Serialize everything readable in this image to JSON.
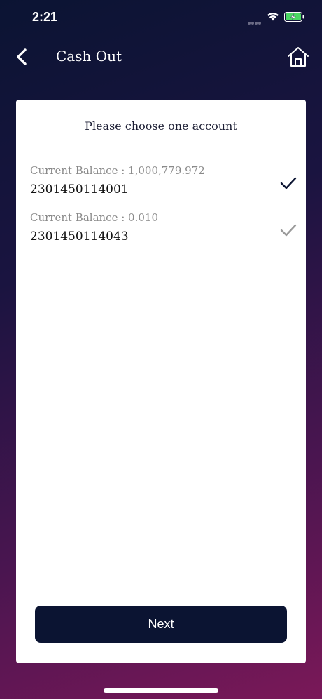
{
  "status_bar": {
    "time": "2:21",
    "icons": [
      "signal-dots-icon",
      "wifi-icon",
      "battery-charging-icon"
    ],
    "battery_color": "#4cd964"
  },
  "nav": {
    "title": "Cash Out",
    "back_icon": "chevron-left-icon",
    "home_icon": "home-icon"
  },
  "card": {
    "heading": "Please choose one account",
    "accounts": [
      {
        "balance_label": "Current Balance : 1,000,779.972",
        "number": "2301450114001",
        "selected": true,
        "check_color": "#0b1432"
      },
      {
        "balance_label": "Current Balance : 0.010",
        "number": "2301450114043",
        "selected": false,
        "check_color": "#9a9a9a"
      }
    ],
    "next_label": "Next"
  },
  "colors": {
    "primary": "#0b1432",
    "background_start": "#0b1433",
    "background_end": "#7a1858"
  }
}
